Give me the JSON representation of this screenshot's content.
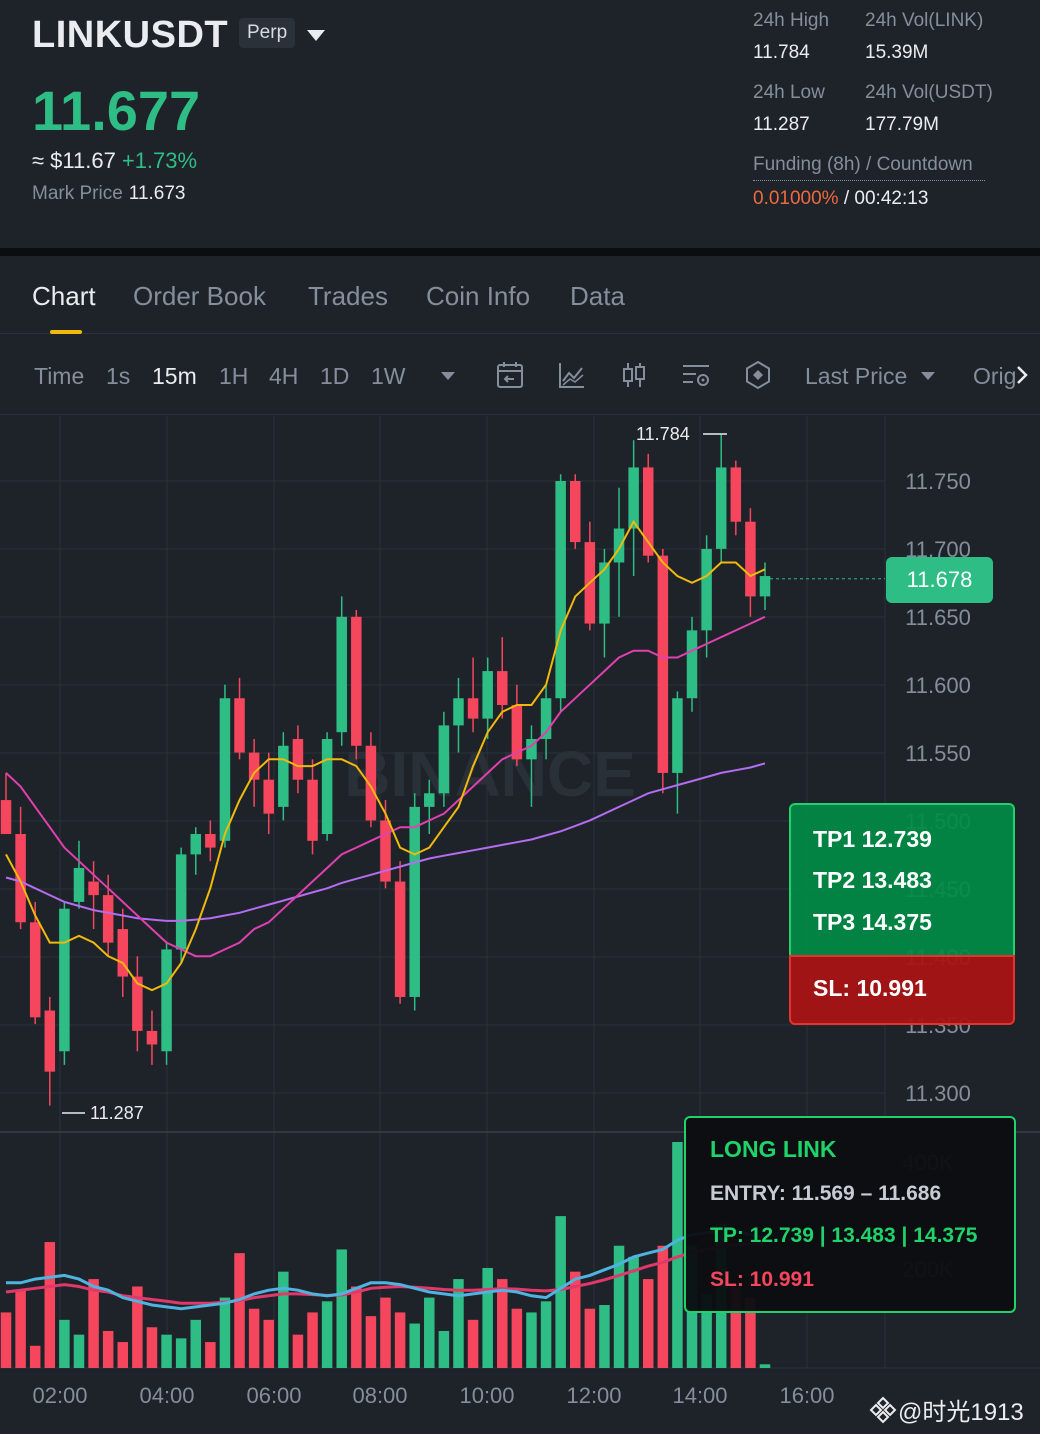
{
  "header": {
    "symbol": "LINKUSDT",
    "contract_type": "Perp",
    "last_price": "11.677",
    "usd_price": "≈ $11.67",
    "change_pct": "+1.73%",
    "mark_price_label": "Mark Price",
    "mark_price": "11.673",
    "stats": {
      "high_label": "24h High",
      "high": "11.784",
      "vol_link_label": "24h Vol(LINK)",
      "vol_link": "15.39M",
      "low_label": "24h Low",
      "low": "11.287",
      "vol_usdt_label": "24h Vol(USDT)",
      "vol_usdt": "177.79M",
      "funding_label": "Funding (8h) / Countdown",
      "funding_rate": "0.01000%",
      "funding_sep": "/",
      "countdown": "00:42:13"
    },
    "colors": {
      "up": "#2ebd85",
      "down": "#f6465d",
      "funding": "#f0683e"
    }
  },
  "tabs": [
    {
      "label": "Chart",
      "active": true
    },
    {
      "label": "Order Book"
    },
    {
      "label": "Trades"
    },
    {
      "label": "Coin Info"
    },
    {
      "label": "Data"
    }
  ],
  "toolbar": {
    "time_label": "Time",
    "intervals": [
      "1s",
      "15m",
      "1H",
      "4H",
      "1D",
      "1W"
    ],
    "active_interval": "15m",
    "icons": [
      "calendar-icon",
      "indicator-icon",
      "candle-type-icon",
      "settings-icon",
      "hexagon-icon"
    ],
    "price_type": "Last Price",
    "orig_label": "Orig"
  },
  "chart_data": {
    "type": "candlestick",
    "watermark": "BINANCE",
    "price_axis": [
      "11.750",
      "11.700",
      "11.650",
      "11.600",
      "11.550",
      "11.500",
      "11.450",
      "11.400",
      "11.350",
      "11.300"
    ],
    "time_axis": [
      "02:00",
      "04:00",
      "06:00",
      "08:00",
      "10:00",
      "12:00",
      "14:00",
      "16:00"
    ],
    "volume_axis": [
      "400K",
      "200K"
    ],
    "high_marker": "11.784",
    "low_marker": "11.287",
    "current_price": "11.678",
    "ylim": [
      11.28,
      11.8
    ],
    "candles": [
      [
        11.515,
        11.535,
        11.49,
        11.49
      ],
      [
        11.49,
        11.51,
        11.42,
        11.425
      ],
      [
        11.425,
        11.44,
        11.35,
        11.355
      ],
      [
        11.36,
        11.37,
        11.29,
        11.315
      ],
      [
        11.33,
        11.44,
        11.32,
        11.435
      ],
      [
        11.44,
        11.485,
        11.435,
        11.465
      ],
      [
        11.455,
        11.47,
        11.42,
        11.445
      ],
      [
        11.445,
        11.46,
        11.4,
        11.41
      ],
      [
        11.42,
        11.435,
        11.37,
        11.385
      ],
      [
        11.385,
        11.4,
        11.33,
        11.345
      ],
      [
        11.345,
        11.36,
        11.32,
        11.335
      ],
      [
        11.33,
        11.41,
        11.32,
        11.405
      ],
      [
        11.405,
        11.48,
        11.395,
        11.475
      ],
      [
        11.475,
        11.495,
        11.46,
        11.49
      ],
      [
        11.49,
        11.5,
        11.47,
        11.48
      ],
      [
        11.485,
        11.6,
        11.48,
        11.59
      ],
      [
        11.59,
        11.605,
        11.545,
        11.55
      ],
      [
        11.55,
        11.56,
        11.51,
        11.53
      ],
      [
        11.53,
        11.55,
        11.49,
        11.505
      ],
      [
        11.51,
        11.565,
        11.5,
        11.555
      ],
      [
        11.56,
        11.57,
        11.52,
        11.53
      ],
      [
        11.53,
        11.545,
        11.475,
        11.485
      ],
      [
        11.49,
        11.565,
        11.485,
        11.56
      ],
      [
        11.565,
        11.665,
        11.555,
        11.65
      ],
      [
        11.65,
        11.655,
        11.545,
        11.555
      ],
      [
        11.555,
        11.565,
        11.495,
        11.5
      ],
      [
        11.5,
        11.515,
        11.45,
        11.455
      ],
      [
        11.455,
        11.47,
        11.365,
        11.37
      ],
      [
        11.37,
        11.52,
        11.36,
        11.51
      ],
      [
        11.51,
        11.53,
        11.49,
        11.52
      ],
      [
        11.52,
        11.58,
        11.51,
        11.57
      ],
      [
        11.57,
        11.605,
        11.55,
        11.59
      ],
      [
        11.59,
        11.62,
        11.565,
        11.575
      ],
      [
        11.575,
        11.62,
        11.56,
        11.61
      ],
      [
        11.61,
        11.635,
        11.575,
        11.585
      ],
      [
        11.585,
        11.6,
        11.54,
        11.545
      ],
      [
        11.545,
        11.57,
        11.51,
        11.56
      ],
      [
        11.56,
        11.6,
        11.545,
        11.59
      ],
      [
        11.59,
        11.755,
        11.58,
        11.75
      ],
      [
        11.75,
        11.755,
        11.7,
        11.705
      ],
      [
        11.705,
        11.72,
        11.64,
        11.645
      ],
      [
        11.645,
        11.7,
        11.62,
        11.69
      ],
      [
        11.69,
        11.745,
        11.65,
        11.715
      ],
      [
        11.715,
        11.78,
        11.68,
        11.76
      ],
      [
        11.76,
        11.77,
        11.69,
        11.695
      ],
      [
        11.695,
        11.7,
        11.52,
        11.535
      ],
      [
        11.535,
        11.595,
        11.505,
        11.59
      ],
      [
        11.59,
        11.65,
        11.58,
        11.64
      ],
      [
        11.64,
        11.71,
        11.62,
        11.7
      ],
      [
        11.7,
        11.784,
        11.69,
        11.76
      ],
      [
        11.76,
        11.765,
        11.71,
        11.72
      ],
      [
        11.72,
        11.73,
        11.65,
        11.665
      ],
      [
        11.665,
        11.69,
        11.655,
        11.68
      ]
    ],
    "volume": [
      150,
      210,
      60,
      340,
      130,
      90,
      240,
      100,
      70,
      220,
      110,
      90,
      80,
      130,
      70,
      190,
      310,
      160,
      130,
      260,
      90,
      150,
      180,
      320,
      220,
      140,
      190,
      150,
      120,
      190,
      100,
      240,
      130,
      270,
      240,
      160,
      150,
      180,
      410,
      260,
      160,
      170,
      330,
      300,
      240,
      330,
      610,
      330,
      200,
      390,
      220,
      190,
      10
    ],
    "vol_ma_fast": [
      230,
      230,
      240,
      245,
      250,
      240,
      220,
      210,
      190,
      180,
      170,
      165,
      160,
      165,
      170,
      175,
      185,
      200,
      210,
      215,
      210,
      200,
      195,
      200,
      215,
      230,
      230,
      225,
      215,
      205,
      200,
      195,
      200,
      205,
      210,
      205,
      195,
      190,
      215,
      240,
      250,
      265,
      280,
      300,
      310,
      320,
      345,
      360,
      365,
      370,
      370,
      360,
      350
    ],
    "vol_ma_slow": [
      205,
      210,
      215,
      220,
      225,
      220,
      210,
      205,
      195,
      190,
      185,
      180,
      175,
      175,
      175,
      178,
      182,
      190,
      195,
      200,
      200,
      198,
      196,
      197,
      205,
      215,
      218,
      220,
      218,
      215,
      212,
      210,
      210,
      212,
      214,
      213,
      210,
      208,
      212,
      220,
      228,
      238,
      250,
      262,
      275,
      285,
      300,
      312,
      320,
      328,
      332,
      334,
      335
    ],
    "ma7": [
      11.475,
      11.455,
      11.43,
      11.41,
      11.41,
      11.415,
      11.41,
      11.4,
      11.395,
      11.38,
      11.375,
      11.38,
      11.395,
      11.42,
      11.45,
      11.49,
      11.515,
      11.535,
      11.545,
      11.545,
      11.54,
      11.54,
      11.545,
      11.545,
      11.54,
      11.525,
      11.505,
      11.48,
      11.475,
      11.48,
      11.495,
      11.51,
      11.54,
      11.565,
      11.58,
      11.585,
      11.585,
      11.6,
      11.64,
      11.665,
      11.675,
      11.685,
      11.7,
      11.72,
      11.705,
      11.69,
      11.68,
      11.675,
      11.68,
      11.69,
      11.69,
      11.68,
      11.685
    ],
    "ma25": [
      11.535,
      11.525,
      11.51,
      11.495,
      11.48,
      11.47,
      11.46,
      11.45,
      11.44,
      11.43,
      11.42,
      11.41,
      11.405,
      11.4,
      11.4,
      11.405,
      11.41,
      11.42,
      11.425,
      11.435,
      11.445,
      11.455,
      11.465,
      11.475,
      11.48,
      11.485,
      11.49,
      11.495,
      11.495,
      11.5,
      11.505,
      11.515,
      11.525,
      11.535,
      11.545,
      11.55,
      11.555,
      11.565,
      11.58,
      11.59,
      11.6,
      11.61,
      11.62,
      11.625,
      11.625,
      11.62,
      11.62,
      11.625,
      11.63,
      11.635,
      11.64,
      11.645,
      11.65
    ],
    "ma99": [
      11.458,
      11.455,
      11.45,
      11.445,
      11.44,
      11.437,
      11.434,
      11.432,
      11.43,
      11.428,
      11.427,
      11.426,
      11.426,
      11.427,
      11.428,
      11.43,
      11.432,
      11.435,
      11.438,
      11.441,
      11.444,
      11.447,
      11.45,
      11.454,
      11.457,
      11.46,
      11.463,
      11.466,
      11.469,
      11.472,
      11.474,
      11.476,
      11.478,
      11.48,
      11.482,
      11.484,
      11.486,
      11.489,
      11.492,
      11.496,
      11.5,
      11.505,
      11.51,
      11.515,
      11.52,
      11.523,
      11.526,
      11.529,
      11.532,
      11.535,
      11.537,
      11.539,
      11.542
    ]
  },
  "overlay": {
    "tp1": "TP1 12.739",
    "tp2": "TP2 13.483",
    "tp3": "TP3 14.375",
    "sl": "SL: 10.991",
    "signal_title": "LONG LINK",
    "signal_entry": "ENTRY: 11.569 – 11.686",
    "signal_tp": "TP: 12.739 | 13.483 | 14.375",
    "signal_sl": "SL: 10.991"
  },
  "watermark_user": "@时光1913"
}
